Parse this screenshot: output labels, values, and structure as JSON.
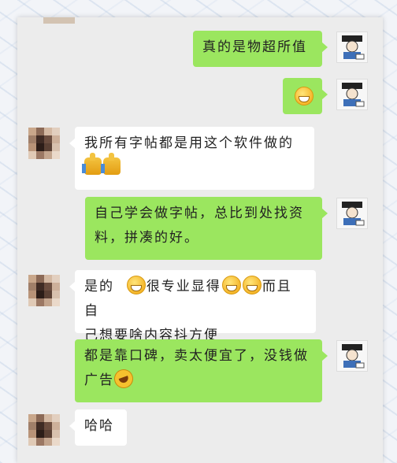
{
  "messages": [
    {
      "side": "right",
      "text": "真的是物超所值"
    },
    {
      "side": "right",
      "text": "",
      "emoji": "grin-emoji"
    },
    {
      "side": "left",
      "line1": "我所有字帖都是用这个软件做的",
      "emoji": "thumbs-up-emoji"
    },
    {
      "side": "right",
      "line1": "自己学会做字帖，总比到处找资",
      "line2": "料，拼凑的好。"
    },
    {
      "side": "left",
      "part1": "是的",
      "part2": "很专业显得",
      "part3": "而且自",
      "line2": "己想要啥内容抖方便"
    },
    {
      "side": "right",
      "line1": "都是靠口碑，卖太便宜了，没钱做",
      "line2": "广告"
    },
    {
      "side": "left",
      "text": "哈哈"
    }
  ],
  "colors": {
    "green_bubble": "#9be65f",
    "white_bubble": "#ffffff",
    "panel": "#ececec"
  }
}
